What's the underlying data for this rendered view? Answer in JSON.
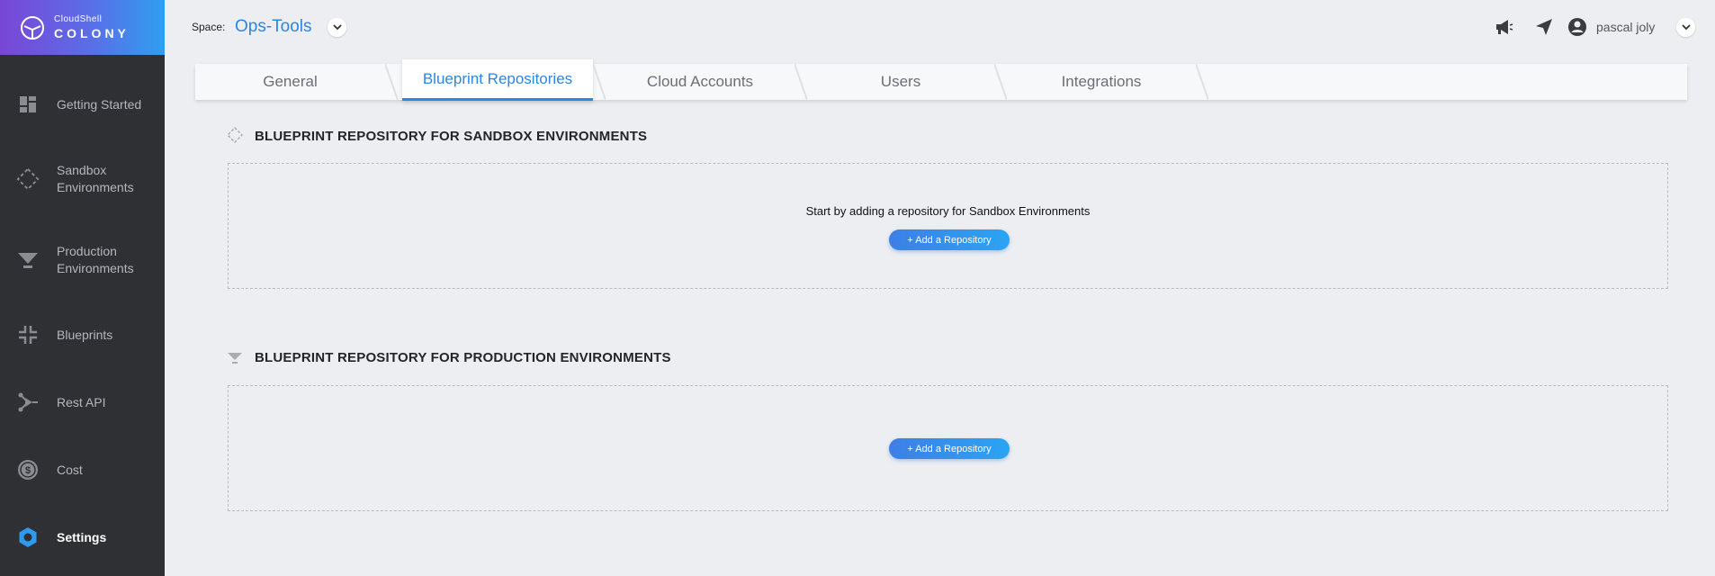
{
  "brand": {
    "small": "CloudShell",
    "big": "COLONY"
  },
  "sidebar": {
    "items": [
      {
        "label": "Getting Started",
        "icon": "dashboard-icon"
      },
      {
        "label": "Sandbox\nEnvironments",
        "icon": "sandbox-diamond-icon"
      },
      {
        "label": "Production\nEnvironments",
        "icon": "production-funnel-icon"
      },
      {
        "label": "Blueprints",
        "icon": "blueprint-icon"
      },
      {
        "label": "Rest API",
        "icon": "api-icon"
      },
      {
        "label": "Cost",
        "icon": "dollar-coin-icon"
      },
      {
        "label": "Settings",
        "icon": "gear-icon",
        "active": true
      }
    ]
  },
  "topbar": {
    "space_label": "Space:",
    "space_value": "Ops-Tools",
    "user_name": "pascal joly",
    "icons": [
      "megaphone-icon",
      "send-icon",
      "user-avatar-icon"
    ]
  },
  "tabs": [
    {
      "label": "General"
    },
    {
      "label": "Blueprint Repositories",
      "active": true
    },
    {
      "label": "Cloud Accounts"
    },
    {
      "label": "Users"
    },
    {
      "label": "Integrations"
    }
  ],
  "sections": {
    "sandbox": {
      "title": "BLUEPRINT REPOSITORY FOR SANDBOX ENVIRONMENTS",
      "empty_text": "Start by adding a repository for Sandbox Environments",
      "button": "+ Add a Repository"
    },
    "production": {
      "title": "BLUEPRINT REPOSITORY FOR PRODUCTION ENVIRONMENTS",
      "button": "+ Add a Repository"
    }
  },
  "colors": {
    "accent": "#2e86de",
    "sidebar": "#2f3034",
    "settings_icon": "#2e9bf0"
  }
}
